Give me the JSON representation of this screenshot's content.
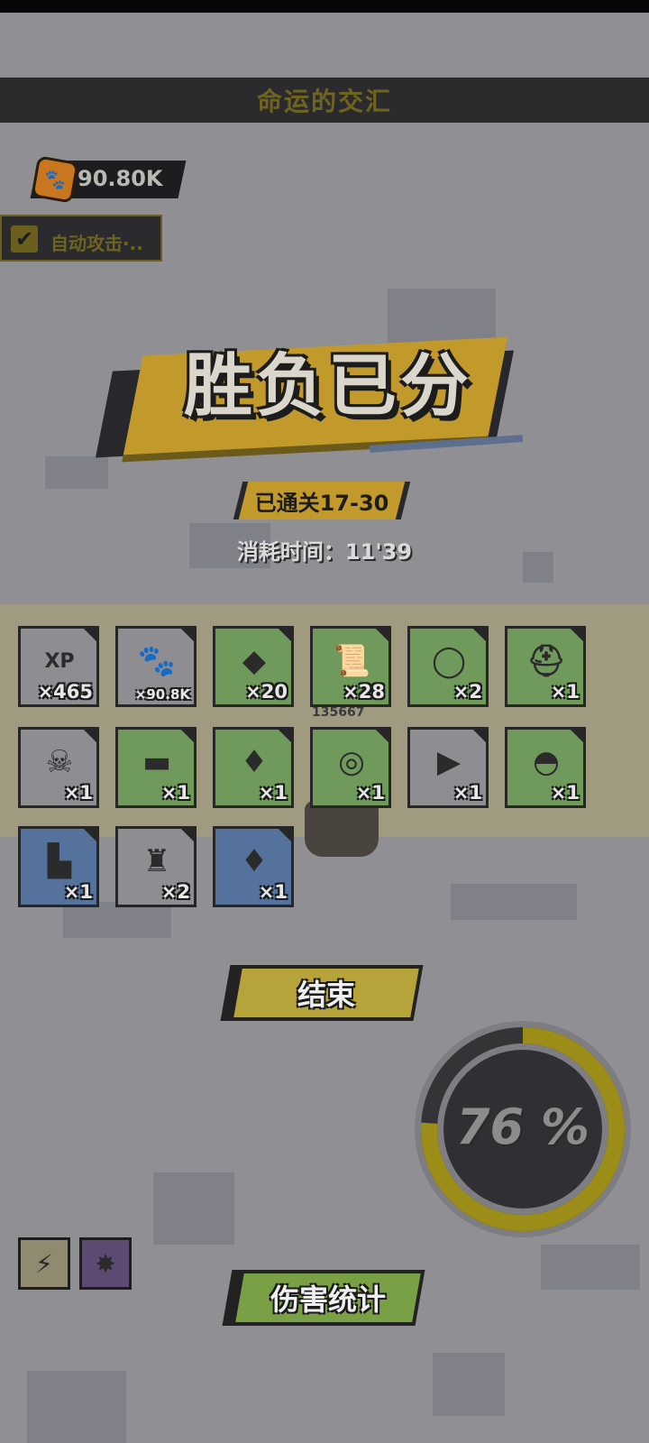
{
  "header": {
    "title": "命运的交汇"
  },
  "currency": {
    "icon": "paw-coin-icon",
    "value": "90.80K"
  },
  "auto_attack": {
    "label": "自动攻击·..",
    "checked": true
  },
  "result": {
    "title": "胜负已分",
    "stage": "已通关17-30",
    "time": "消耗时间：11'39"
  },
  "rewards": [
    {
      "icon": "xp-orb-icon",
      "art": "XP",
      "count": "×465",
      "bg": "gray"
    },
    {
      "icon": "paw-coin-icon",
      "art": "🐾",
      "count": "×90.8K",
      "bg": "gray"
    },
    {
      "icon": "purple-gem-icon",
      "art": "◆",
      "count": "×20",
      "bg": "green"
    },
    {
      "icon": "scroll-icon",
      "art": "📜",
      "count": "×28",
      "bg": "green"
    },
    {
      "icon": "ring-icon",
      "art": "◯",
      "count": "×2",
      "bg": "green"
    },
    {
      "icon": "pink-helmet-icon",
      "art": "⛑",
      "count": "×1",
      "bg": "green"
    },
    {
      "icon": "white-mask-icon",
      "art": "☠",
      "count": "×1",
      "bg": "gray"
    },
    {
      "icon": "blue-sandal-icon",
      "art": "▬",
      "count": "×1",
      "bg": "green"
    },
    {
      "icon": "gold-amulet-icon",
      "art": "♦",
      "count": "×1",
      "bg": "green"
    },
    {
      "icon": "phoenix-ring-icon",
      "art": "◎",
      "count": "×1",
      "bg": "green"
    },
    {
      "icon": "blue-ticket-icon",
      "art": "▶",
      "count": "×1",
      "bg": "gray"
    },
    {
      "icon": "white-cap-icon",
      "art": "◓",
      "count": "×1",
      "bg": "green"
    },
    {
      "icon": "red-boot-icon",
      "art": "▙",
      "count": "×1",
      "bg": "blue"
    },
    {
      "icon": "red-armor-icon",
      "art": "♜",
      "count": "×2",
      "bg": "gray"
    },
    {
      "icon": "gold-amulet-icon",
      "art": "♦",
      "count": "×1",
      "bg": "blue"
    }
  ],
  "battle": {
    "hp_number": "135667"
  },
  "buttons": {
    "end": "结束",
    "damage_stats": "伤害统计"
  },
  "gauge": {
    "percent_label": "76 %",
    "progress": 0.76,
    "color": "#9c8c18"
  },
  "skills": [
    {
      "icon": "lightning-skill-icon",
      "glyph": "⚡"
    },
    {
      "icon": "claw-skill-icon",
      "glyph": "✸"
    }
  ]
}
